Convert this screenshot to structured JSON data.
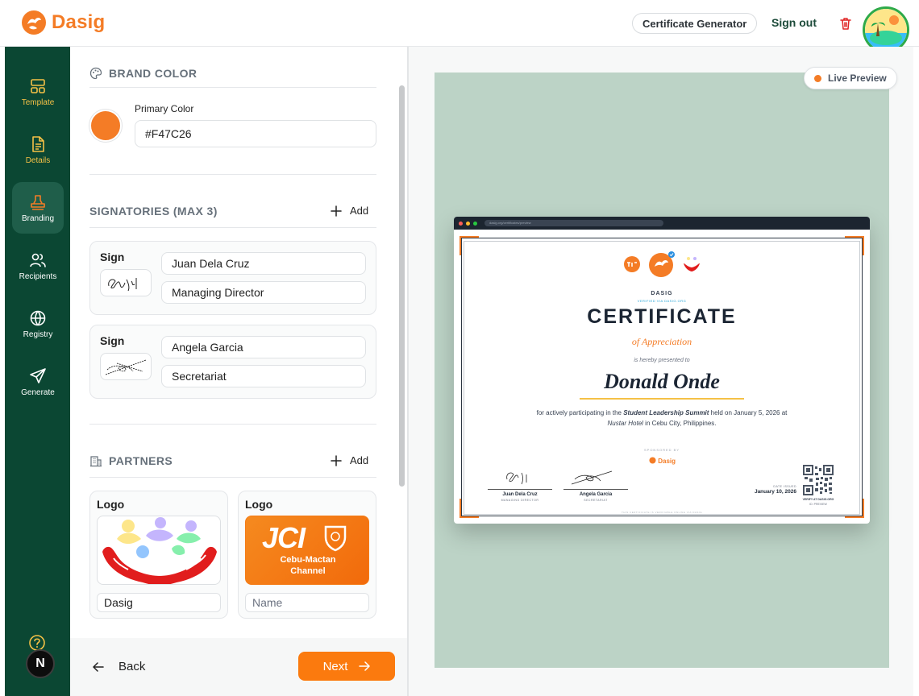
{
  "header": {
    "brand": "Dasig",
    "certificate_generator": "Certificate Generator",
    "sign_out": "Sign out"
  },
  "sidebar": {
    "items": [
      {
        "label": "Template"
      },
      {
        "label": "Details"
      },
      {
        "label": "Branding"
      },
      {
        "label": "Recipients"
      },
      {
        "label": "Registry"
      },
      {
        "label": "Generate"
      }
    ],
    "active": "Branding",
    "badge": "N"
  },
  "brand_color": {
    "section_title": "BRAND COLOR",
    "field_label": "Primary Color",
    "value": "#F47C26"
  },
  "signatories": {
    "section_title": "SIGNATORIES (MAX 3)",
    "add_label": "Add",
    "sign_label": "Sign",
    "items": [
      {
        "name": "Juan Dela Cruz",
        "role": "Managing Director"
      },
      {
        "name": "Angela Garcia",
        "role": "Secretariat"
      }
    ]
  },
  "partners": {
    "section_title": "PARTNERS",
    "add_label": "Add",
    "logo_label": "Logo",
    "items": [
      {
        "name": "Dasig",
        "placeholder": "Name"
      },
      {
        "name": "",
        "placeholder": "Name",
        "logo_text_main": "JCI",
        "logo_text_sub1": "Cebu-Mactan",
        "logo_text_sub2": "Channel"
      }
    ]
  },
  "footer": {
    "back_label": "Back",
    "next_label": "Next"
  },
  "preview": {
    "badge": "Live Preview",
    "url": "dasig.org/certificates/preview",
    "certificate": {
      "org": "DASIG",
      "verified": "VERIFIED VIA DASIG.ORG",
      "title": "CERTIFICATE",
      "subtitle": "of Appreciation",
      "presented": "is hereby presented to",
      "recipient": "Donald Onde",
      "body_prefix": "for actively participating in the ",
      "event": "Student Leadership Summit",
      "body_middle": " held on January 5, 2026 at",
      "venue": "Nustar Hotel",
      "body_suffix": " in Cebu City, Philippines.",
      "sponsored_by": "SPONSORED BY",
      "sponsor": "Dasig",
      "signatories": [
        {
          "name": "Juan Dela Cruz",
          "role": "MANAGING DIRECTOR"
        },
        {
          "name": "Angela Garcia",
          "role": "SECRETARIAT"
        }
      ],
      "date_label": "DATE ISSUED",
      "date": "January 10, 2026",
      "verify_label": "VERIFY AT DASIG.ORG",
      "verify_id": "ID: PREVIEW",
      "footer_micro": "THIS CERTIFICATE IS VERIFIABLE ONLINE VIA DASIG"
    }
  },
  "colors": {
    "accent": "#F47C26",
    "sidebar": "#0B4733",
    "sidebar_active": "#1F5E4A",
    "nav_gold": "#F5C146",
    "preview_bg": "#BCD3C6"
  }
}
